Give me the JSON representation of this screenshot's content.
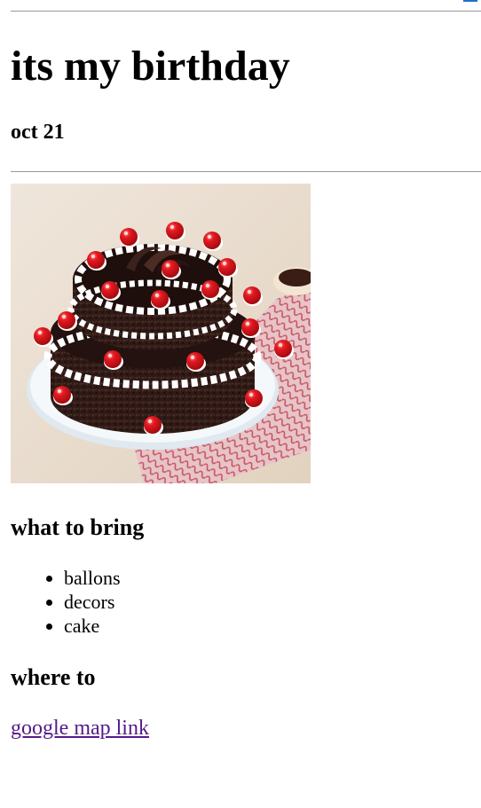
{
  "header": {
    "title": "its my birthday",
    "date": "oct 21"
  },
  "image": {
    "icon": "birthday-cake-photo",
    "colors": {
      "background": "#e9dccd",
      "plate": "#eef4f8",
      "chocolate": "#2a1714",
      "cream": "#ffffff",
      "cherry": "#d9141a",
      "cloth": "#c9575f"
    }
  },
  "bring": {
    "heading": "what to bring",
    "items": [
      {
        "label": "ballons"
      },
      {
        "label": "decors"
      },
      {
        "label": "cake"
      }
    ]
  },
  "where": {
    "heading": "where to",
    "link_label": "google map link"
  }
}
